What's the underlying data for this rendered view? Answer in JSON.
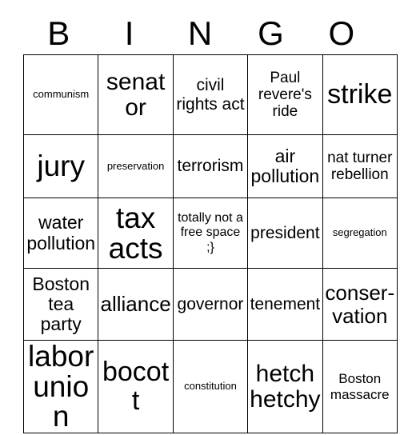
{
  "card": {
    "header_letters": [
      "B",
      "I",
      "N",
      "G",
      "O"
    ],
    "columns": 5,
    "rows": 5,
    "border_color": "#000000",
    "text_color": "#000000",
    "background_color": "#ffffff",
    "free_space": {
      "row": 3,
      "column": 3,
      "label": "totally not a free space ;}"
    },
    "cells": [
      [
        {
          "text": "communism",
          "size": "xs"
        },
        {
          "text": "senator",
          "size": "xxl"
        },
        {
          "text": "civil rights act",
          "size": "ml"
        },
        {
          "text": "Paul revere's ride",
          "size": "m"
        },
        {
          "text": "strike",
          "size": "3xl"
        }
      ],
      [
        {
          "text": "jury",
          "size": "4xl"
        },
        {
          "text": "preservation",
          "size": "xs"
        },
        {
          "text": "terrorism",
          "size": "ml"
        },
        {
          "text": "air pollution",
          "size": "l"
        },
        {
          "text": "nat turner rebellion",
          "size": "m"
        }
      ],
      [
        {
          "text": "water pollution",
          "size": "l"
        },
        {
          "text": "tax acts",
          "size": "4xl"
        },
        {
          "text": "totally not a free space ;}",
          "size": "s"
        },
        {
          "text": "president",
          "size": "ml"
        },
        {
          "text": "segregation",
          "size": "xs"
        }
      ],
      [
        {
          "text": "Boston tea party",
          "size": "l"
        },
        {
          "text": "alliance",
          "size": "xl"
        },
        {
          "text": "governor",
          "size": "ml"
        },
        {
          "text": "tenement",
          "size": "ml"
        },
        {
          "text": "conser-vation",
          "size": "xl"
        }
      ],
      [
        {
          "text": "labor union",
          "size": "4xl"
        },
        {
          "text": "bocott",
          "size": "3xl"
        },
        {
          "text": "constitution",
          "size": "xs"
        },
        {
          "text": "hetch hetchy",
          "size": "xxl"
        },
        {
          "text": "Boston massacre",
          "size": "sm"
        }
      ]
    ]
  }
}
